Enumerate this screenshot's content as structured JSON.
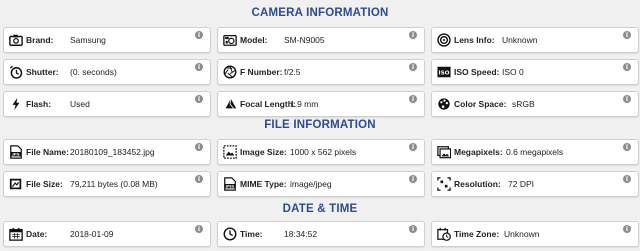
{
  "sections": {
    "camera": "CAMERA INFORMATION",
    "file": "FILE INFORMATION",
    "datetime": "DATE & TIME"
  },
  "camera": {
    "brand": {
      "label": "Brand:",
      "value": "Samsung"
    },
    "model": {
      "label": "Model:",
      "value": "SM-N9005"
    },
    "lens": {
      "label": "Lens Info:",
      "value": "Unknown"
    },
    "shutter": {
      "label": "Shutter:",
      "value": "(0. seconds)"
    },
    "fnumber": {
      "label": "F Number:",
      "value": "f/2.5"
    },
    "iso": {
      "label": "ISO Speed:",
      "value": "ISO 0"
    },
    "flash": {
      "label": "Flash:",
      "value": "Used"
    },
    "focal": {
      "label": "Focal Length:",
      "value": "1.9 mm"
    },
    "colorspace": {
      "label": "Color Space:",
      "value": "sRGB"
    }
  },
  "file": {
    "name": {
      "label": "File Name:",
      "value": "20180109_183452.jpg"
    },
    "imagesize": {
      "label": "Image Size:",
      "value": "1000 x 562 pixels"
    },
    "megapixels": {
      "label": "Megapixels:",
      "value": "0.6 megapixels"
    },
    "filesize": {
      "label": "File Size:",
      "value": "79,211 bytes (0.08 MB)"
    },
    "mime": {
      "label": "MIME Type:",
      "value": "image/jpeg"
    },
    "resolution": {
      "label": "Resolution:",
      "value": "72 DPI"
    }
  },
  "datetime": {
    "date": {
      "label": "Date:",
      "value": "2018-01-09"
    },
    "time": {
      "label": "Time:",
      "value": "18:34:52"
    },
    "timezone": {
      "label": "Time Zone:",
      "value": "Unknown"
    }
  },
  "info_glyph": "i",
  "colors": {
    "accent": "#2e4a92",
    "info_badge": "#8c8c8c"
  }
}
